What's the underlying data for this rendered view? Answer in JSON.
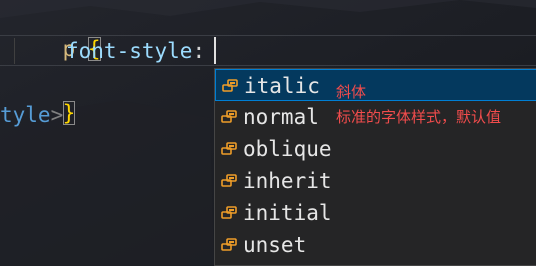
{
  "code": {
    "line1_selector": "p",
    "line1_brace": "{",
    "line2_property": "font-style",
    "line2_colon": ":",
    "line3_brace": "}",
    "line4_tag": "tyle",
    "line4_bracket": ">"
  },
  "suggestions": [
    {
      "label": "italic",
      "icon": "property-icon"
    },
    {
      "label": "normal",
      "icon": "property-icon"
    },
    {
      "label": "oblique",
      "icon": "property-icon"
    },
    {
      "label": "inherit",
      "icon": "property-icon"
    },
    {
      "label": "initial",
      "icon": "property-icon"
    },
    {
      "label": "unset",
      "icon": "property-icon"
    }
  ],
  "selected_index": 0,
  "annotations": {
    "italic_note": "斜体",
    "normal_note": "标准的字体样式，默认值"
  },
  "colors": {
    "selector": "#d7ba7d",
    "brace": "#ffd700",
    "property": "#9cdcfe",
    "tag": "#569cd6",
    "selection": "#04395e",
    "annotation": "#f14c4c",
    "icon": "#ee9d28"
  }
}
